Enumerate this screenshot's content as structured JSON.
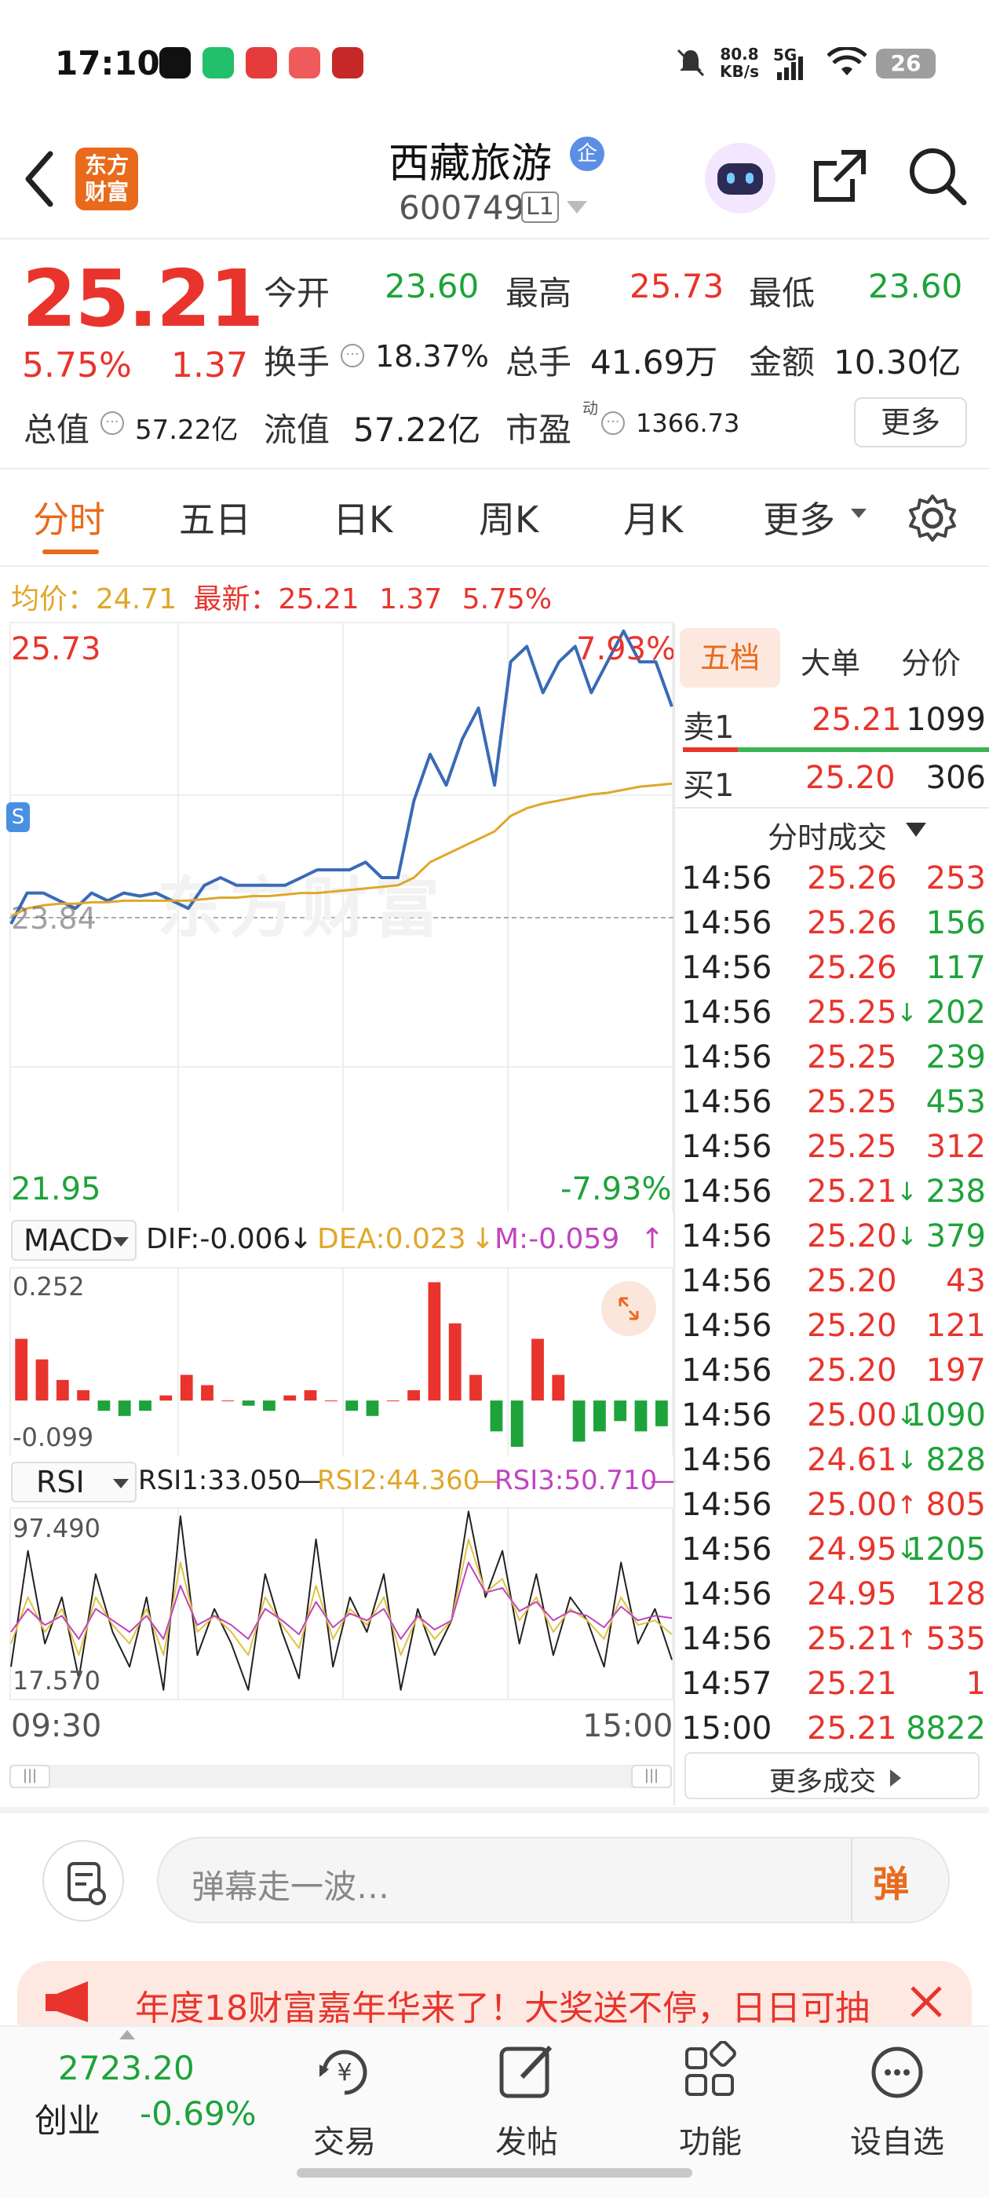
{
  "status_bar": {
    "time": "17:10",
    "net_speed_value": "80.8",
    "net_speed_unit": "KB/s",
    "network": "5G",
    "battery": "26"
  },
  "header": {
    "back_icon": "chevron-left-icon",
    "logo_text_1": "东方",
    "logo_text_2": "财富",
    "stock_name": "西藏旅游",
    "badge": "企",
    "stock_code": "600749",
    "level": "L1",
    "share_icon": "share-icon",
    "search_icon": "search-icon"
  },
  "quote": {
    "price": "25.21",
    "change_pct": "5.75%",
    "change": "1.37",
    "open_label": "今开",
    "open": "23.60",
    "high_label": "最高",
    "high": "25.73",
    "low_label": "最低",
    "low": "23.60",
    "turnover_label": "换手",
    "turnover": "18.37%",
    "volume_label": "总手",
    "volume": "41.69万",
    "amount_label": "金额",
    "amount": "10.30亿",
    "mktcap_label": "总值",
    "mktcap": "57.22亿",
    "float_label": "流值",
    "float": "57.22亿",
    "pe_label": "市盈",
    "pe_sup": "动",
    "pe": "1366.73",
    "more_button": "更多"
  },
  "tabs": [
    "分时",
    "五日",
    "日K",
    "周K",
    "月K",
    "更多"
  ],
  "info_line": {
    "avg_label": "均价：",
    "avg": "24.71",
    "latest_label": "最新：",
    "latest": "25.21",
    "change": "1.37",
    "change_pct": "5.75%"
  },
  "chart_data": [
    {
      "type": "line",
      "title": "分时",
      "x_start": "09:30",
      "x_end": "15:00",
      "y_max_label": "25.73",
      "y_min_label": "21.95",
      "pct_max_label": "7.93%",
      "pct_min_label": "-7.93%",
      "prev_close": "23.84",
      "watermark": "东方财富",
      "series": [
        {
          "color": "#3a6ab8",
          "values": [
            23.8,
            24.0,
            24.0,
            23.95,
            23.9,
            24.0,
            23.95,
            24.0,
            23.98,
            24.0,
            23.95,
            23.9,
            24.05,
            24.1,
            24.05,
            24.05,
            24.05,
            24.05,
            24.1,
            24.15,
            24.15,
            24.15,
            24.2,
            24.1,
            24.1,
            24.6,
            24.9,
            24.7,
            25.0,
            25.2,
            24.7,
            25.5,
            25.6,
            25.3,
            25.5,
            25.6,
            25.3,
            25.5,
            25.7,
            25.5,
            25.5,
            25.21
          ]
        },
        {
          "color": "#e0a72a",
          "values": [
            23.85,
            23.9,
            23.92,
            23.93,
            23.93,
            23.94,
            23.94,
            23.95,
            23.95,
            23.95,
            23.95,
            23.95,
            23.96,
            23.97,
            23.97,
            23.98,
            23.98,
            23.99,
            24.0,
            24.0,
            24.01,
            24.02,
            24.03,
            24.04,
            24.05,
            24.1,
            24.2,
            24.25,
            24.3,
            24.35,
            24.4,
            24.5,
            24.55,
            24.58,
            24.6,
            24.62,
            24.64,
            24.65,
            24.67,
            24.69,
            24.7,
            24.71
          ]
        }
      ],
      "ylim": [
        21.95,
        25.73
      ]
    },
    {
      "type": "bar",
      "title": "MACD",
      "dif_label": "DIF:-0.006",
      "dea_label": "DEA:0.023",
      "m_label": "M:-0.059",
      "y_max_label": "0.252",
      "y_min_label": "-0.099",
      "ylim": [
        -0.099,
        0.252
      ],
      "values": [
        0.12,
        0.08,
        0.04,
        0.02,
        -0.02,
        -0.03,
        -0.02,
        0.01,
        0.05,
        0.03,
        0.0,
        -0.01,
        -0.02,
        0.01,
        0.02,
        0.0,
        -0.02,
        -0.03,
        0.0,
        0.02,
        0.23,
        0.15,
        0.05,
        -0.06,
        -0.09,
        0.12,
        0.05,
        -0.08,
        -0.06,
        -0.04,
        -0.06,
        -0.05
      ]
    },
    {
      "type": "line",
      "title": "RSI",
      "rsi1_label": "RSI1:33.050",
      "rsi2_label": "RSI2:44.360",
      "rsi3_label": "RSI3:50.710",
      "y_max_label": "97.490",
      "y_min_label": "17.570",
      "ylim": [
        17.57,
        97.49
      ],
      "series": [
        {
          "name": "RSI1",
          "color": "#222222",
          "values": [
            30,
            80,
            40,
            60,
            25,
            70,
            45,
            30,
            60,
            20,
            95,
            35,
            55,
            40,
            20,
            70,
            45,
            25,
            85,
            30,
            60,
            45,
            70,
            20,
            55,
            35,
            50,
            97,
            60,
            80,
            40,
            70,
            35,
            60,
            50,
            30,
            75,
            40,
            55,
            33
          ]
        },
        {
          "name": "RSI2",
          "color": "#e0c240",
          "values": [
            40,
            60,
            45,
            55,
            35,
            60,
            48,
            40,
            55,
            35,
            75,
            45,
            52,
            45,
            35,
            60,
            48,
            38,
            65,
            42,
            55,
            48,
            60,
            35,
            52,
            42,
            50,
            85,
            62,
            68,
            50,
            60,
            45,
            55,
            50,
            42,
            60,
            48,
            50,
            44
          ]
        },
        {
          "name": "RSI3",
          "color": "#c044c0",
          "values": [
            45,
            55,
            48,
            52,
            42,
            55,
            50,
            45,
            52,
            42,
            65,
            48,
            52,
            48,
            42,
            55,
            50,
            44,
            58,
            47,
            53,
            50,
            55,
            42,
            52,
            46,
            50,
            75,
            62,
            64,
            54,
            58,
            50,
            54,
            52,
            47,
            56,
            50,
            52,
            51
          ]
        }
      ]
    }
  ],
  "order_book": {
    "tabs": [
      "五档",
      "大单",
      "分价"
    ],
    "sell1": {
      "label": "卖1",
      "price": "25.21",
      "vol": "1099"
    },
    "buy1": {
      "label": "买1",
      "price": "25.20",
      "vol": "306"
    },
    "trades_title": "分时成交",
    "trades": [
      {
        "time": "14:56",
        "price": "25.26",
        "vol": "253",
        "dir": "",
        "pc": "red",
        "vc": "red"
      },
      {
        "time": "14:56",
        "price": "25.26",
        "vol": "156",
        "dir": "",
        "pc": "red",
        "vc": "green"
      },
      {
        "time": "14:56",
        "price": "25.26",
        "vol": "117",
        "dir": "",
        "pc": "red",
        "vc": "green"
      },
      {
        "time": "14:56",
        "price": "25.25",
        "vol": "202",
        "dir": "↓",
        "pc": "red",
        "vc": "green"
      },
      {
        "time": "14:56",
        "price": "25.25",
        "vol": "239",
        "dir": "",
        "pc": "red",
        "vc": "green"
      },
      {
        "time": "14:56",
        "price": "25.25",
        "vol": "453",
        "dir": "",
        "pc": "red",
        "vc": "green"
      },
      {
        "time": "14:56",
        "price": "25.25",
        "vol": "312",
        "dir": "",
        "pc": "red",
        "vc": "red"
      },
      {
        "time": "14:56",
        "price": "25.21",
        "vol": "238",
        "dir": "↓",
        "pc": "red",
        "vc": "green"
      },
      {
        "time": "14:56",
        "price": "25.20",
        "vol": "379",
        "dir": "↓",
        "pc": "red",
        "vc": "green"
      },
      {
        "time": "14:56",
        "price": "25.20",
        "vol": "43",
        "dir": "",
        "pc": "red",
        "vc": "red"
      },
      {
        "time": "14:56",
        "price": "25.20",
        "vol": "121",
        "dir": "",
        "pc": "red",
        "vc": "red"
      },
      {
        "time": "14:56",
        "price": "25.20",
        "vol": "197",
        "dir": "",
        "pc": "red",
        "vc": "red"
      },
      {
        "time": "14:56",
        "price": "25.00",
        "vol": "1090",
        "dir": "↓",
        "pc": "red",
        "vc": "green"
      },
      {
        "time": "14:56",
        "price": "24.61",
        "vol": "828",
        "dir": "↓",
        "pc": "red",
        "vc": "green"
      },
      {
        "time": "14:56",
        "price": "25.00",
        "vol": "805",
        "dir": "↑",
        "pc": "red",
        "vc": "red"
      },
      {
        "time": "14:56",
        "price": "24.95",
        "vol": "1205",
        "dir": "↓",
        "pc": "red",
        "vc": "green"
      },
      {
        "time": "14:56",
        "price": "24.95",
        "vol": "128",
        "dir": "",
        "pc": "red",
        "vc": "red"
      },
      {
        "time": "14:56",
        "price": "25.21",
        "vol": "535",
        "dir": "↑",
        "pc": "red",
        "vc": "red"
      },
      {
        "time": "14:57",
        "price": "25.21",
        "vol": "1",
        "dir": "",
        "pc": "red",
        "vc": "red"
      },
      {
        "time": "15:00",
        "price": "25.21",
        "vol": "8822",
        "dir": "",
        "pc": "red",
        "vc": "green"
      }
    ],
    "more_trades": "更多成交"
  },
  "comment": {
    "placeholder": "弹幕走一波…",
    "danmu_icon": "弹"
  },
  "banner": {
    "text": "年度18财富嘉年华来了！大奖送不停，日日可抽",
    "close_icon": "close-icon",
    "horn_icon": "megaphone-icon"
  },
  "bottom_nav": {
    "index_value": "2723.20",
    "index_name": "创业",
    "index_change": "-0.69%",
    "items": [
      {
        "label": "交易",
        "icon": "yen-refresh-icon"
      },
      {
        "label": "发帖",
        "icon": "edit-icon"
      },
      {
        "label": "功能",
        "icon": "grid-icon"
      },
      {
        "label": "设自选",
        "icon": "more-circle-icon"
      }
    ]
  },
  "colors": {
    "up": "#e8342c",
    "down": "#1ea33a",
    "price_line": "#3a6ab8",
    "avg_line": "#e0a72a",
    "accent": "#e96a1b"
  }
}
